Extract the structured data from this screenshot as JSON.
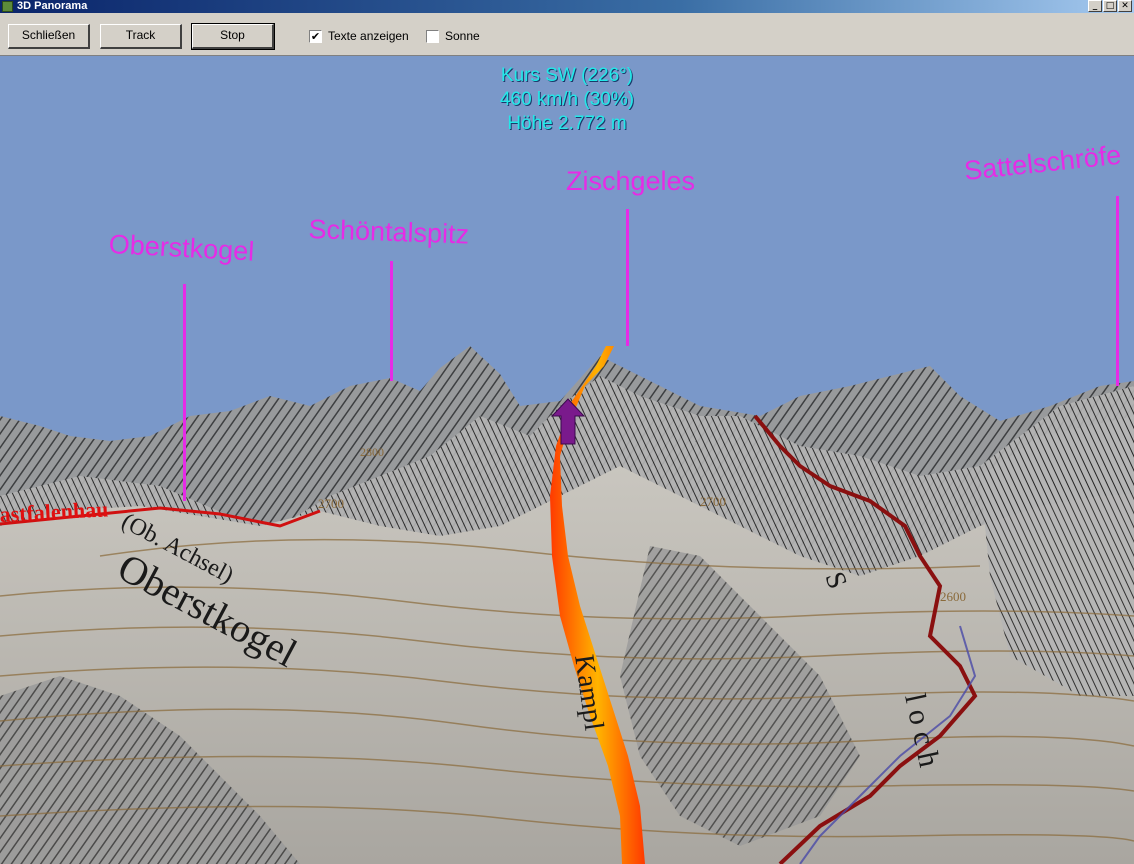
{
  "window": {
    "title": "3D Panorama",
    "minimize_glyph": "_",
    "maximize_glyph": "□",
    "close_glyph": "✕"
  },
  "toolbar": {
    "buttons": [
      {
        "label": "Schließen"
      },
      {
        "label": "Track"
      },
      {
        "label": "Stop"
      }
    ],
    "checkboxes": [
      {
        "label": "Texte anzeigen",
        "checked": true,
        "mark": "✔"
      },
      {
        "label": "Sonne",
        "checked": false,
        "mark": ""
      }
    ]
  },
  "hud": {
    "heading": "Kurs SW (226°)",
    "speed": "460 km/h (30%)",
    "altitude": "Höhe 2.772 m"
  },
  "peaks": [
    {
      "name": "Oberstkogel"
    },
    {
      "name": "Schöntalspitz"
    },
    {
      "name": "Zischgeles"
    },
    {
      "name": "Sattelschröfe"
    }
  ],
  "map_labels": {
    "hut": "astfalenhau",
    "peak_map_text": "Oberstkogel",
    "achsel": "(Ob. Achsel)",
    "valley": "Kampl",
    "side_a": "S",
    "side_b": "l o c h",
    "contour_2700": "2700",
    "contour_2600": "2600",
    "contour_2800": "2800"
  },
  "colors": {
    "sky": "#7a98c9",
    "hud_text": "#23e8e8",
    "peak_label": "#e62be6",
    "track_outer": "#ff4a00",
    "track_inner": "#ffb000",
    "marker": "#7a1a8c",
    "trail": "#8a1010"
  },
  "icons": {
    "app": "mountain-app-icon",
    "marker": "position-arrow-icon"
  }
}
